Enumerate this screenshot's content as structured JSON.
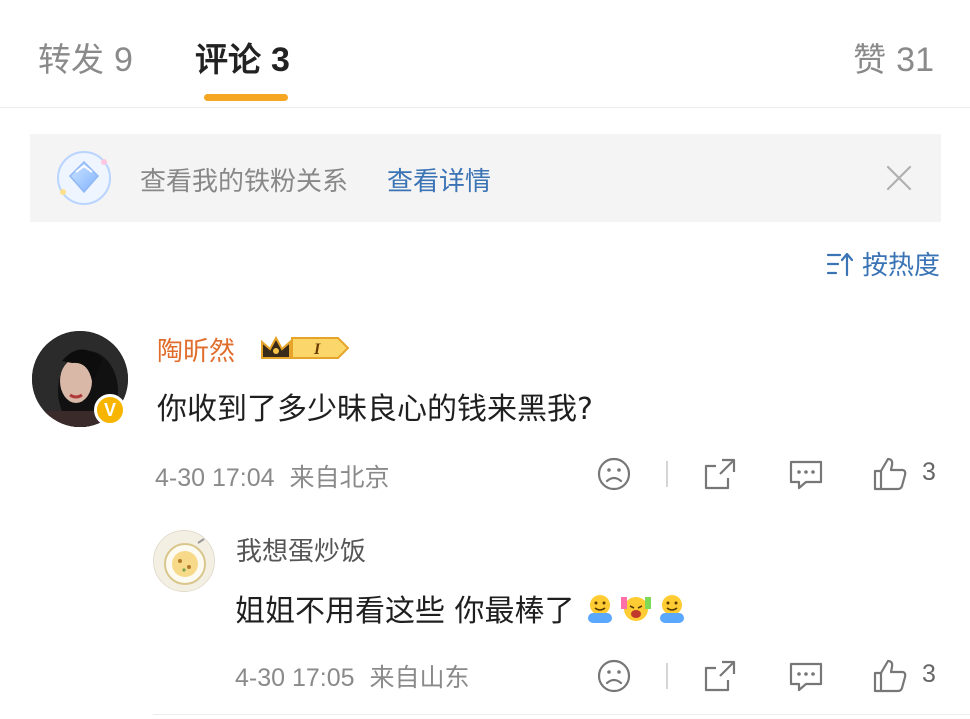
{
  "tabs": {
    "forward": {
      "label": "转发",
      "count": "9"
    },
    "comment": {
      "label": "评论",
      "count": "3"
    },
    "like": {
      "label": "赞",
      "count": "31"
    }
  },
  "banner": {
    "text": "查看我的铁粉关系",
    "link": "查看详情"
  },
  "sort": {
    "label": "按热度"
  },
  "comment": {
    "username": "陶昕然",
    "text": "你收到了多少昧良心的钱来黑我?",
    "time": "4-30 17:04",
    "location": "来自北京",
    "like_count": "3",
    "badge_level": "I",
    "verified_mark": "V"
  },
  "reply": {
    "username": "我想蛋炒饭",
    "text": "姐姐不用看这些 你最棒了",
    "time": "4-30 17:05",
    "location": "来自山东",
    "like_count": "3",
    "emojis": [
      "hug-emoji",
      "cheer-emoji",
      "hug-emoji"
    ]
  },
  "colors": {
    "accent": "#f5a623",
    "link": "#3b74b5",
    "username": "#e06d2c"
  }
}
